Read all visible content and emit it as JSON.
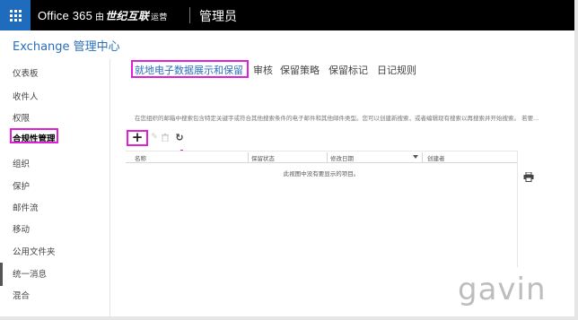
{
  "topbar": {
    "brand_office": "Office 365",
    "brand_by": "由",
    "brand_partner": "世纪互联",
    "brand_operated": "运营",
    "admin_title": "管理员"
  },
  "page_title": "Exchange 管理中心",
  "sidebar": {
    "items": [
      {
        "label": "仪表板"
      },
      {
        "label": "收件人"
      },
      {
        "label": "权限"
      },
      {
        "label": "合规性管理"
      },
      {
        "label": "组织"
      },
      {
        "label": "保护"
      },
      {
        "label": "邮件流"
      },
      {
        "label": "移动"
      },
      {
        "label": "公用文件夹"
      },
      {
        "label": "统一消息"
      },
      {
        "label": "混合"
      }
    ],
    "active_index": 3
  },
  "tabs": [
    {
      "label": "就地电子数据展示和保留"
    },
    {
      "label": "审核"
    },
    {
      "label": "保留策略"
    },
    {
      "label": "保留标记"
    },
    {
      "label": "日记规则"
    }
  ],
  "description": "在您组织的邮箱中搜索包含特定关键字或符合其他搜索条件的电子邮件和其他邮件类型。您可以创建新搜索，或者编辑现有搜索以再搜索并开始搜索。 若要...",
  "toolbar": {
    "add": "+",
    "edit": "✎",
    "delete": "🗑",
    "refresh": "↻"
  },
  "table": {
    "columns": [
      "名称",
      "保留状态",
      "修改日期",
      "创建者"
    ],
    "empty_message": "此视图中没有要显示的项目。"
  },
  "watermark": "gavin",
  "colors": {
    "topbar_bg": "#000000",
    "waffle_bg": "#1f6bbd",
    "accent_blue": "#2a6fbd",
    "highlight_magenta": "#e020d6"
  },
  "icons": {
    "waffle": "app-launcher-icon",
    "add": "plus-icon",
    "edit": "pencil-icon",
    "delete": "trash-icon",
    "refresh": "refresh-icon",
    "print": "printer-icon",
    "sort": "caret-down-icon"
  }
}
